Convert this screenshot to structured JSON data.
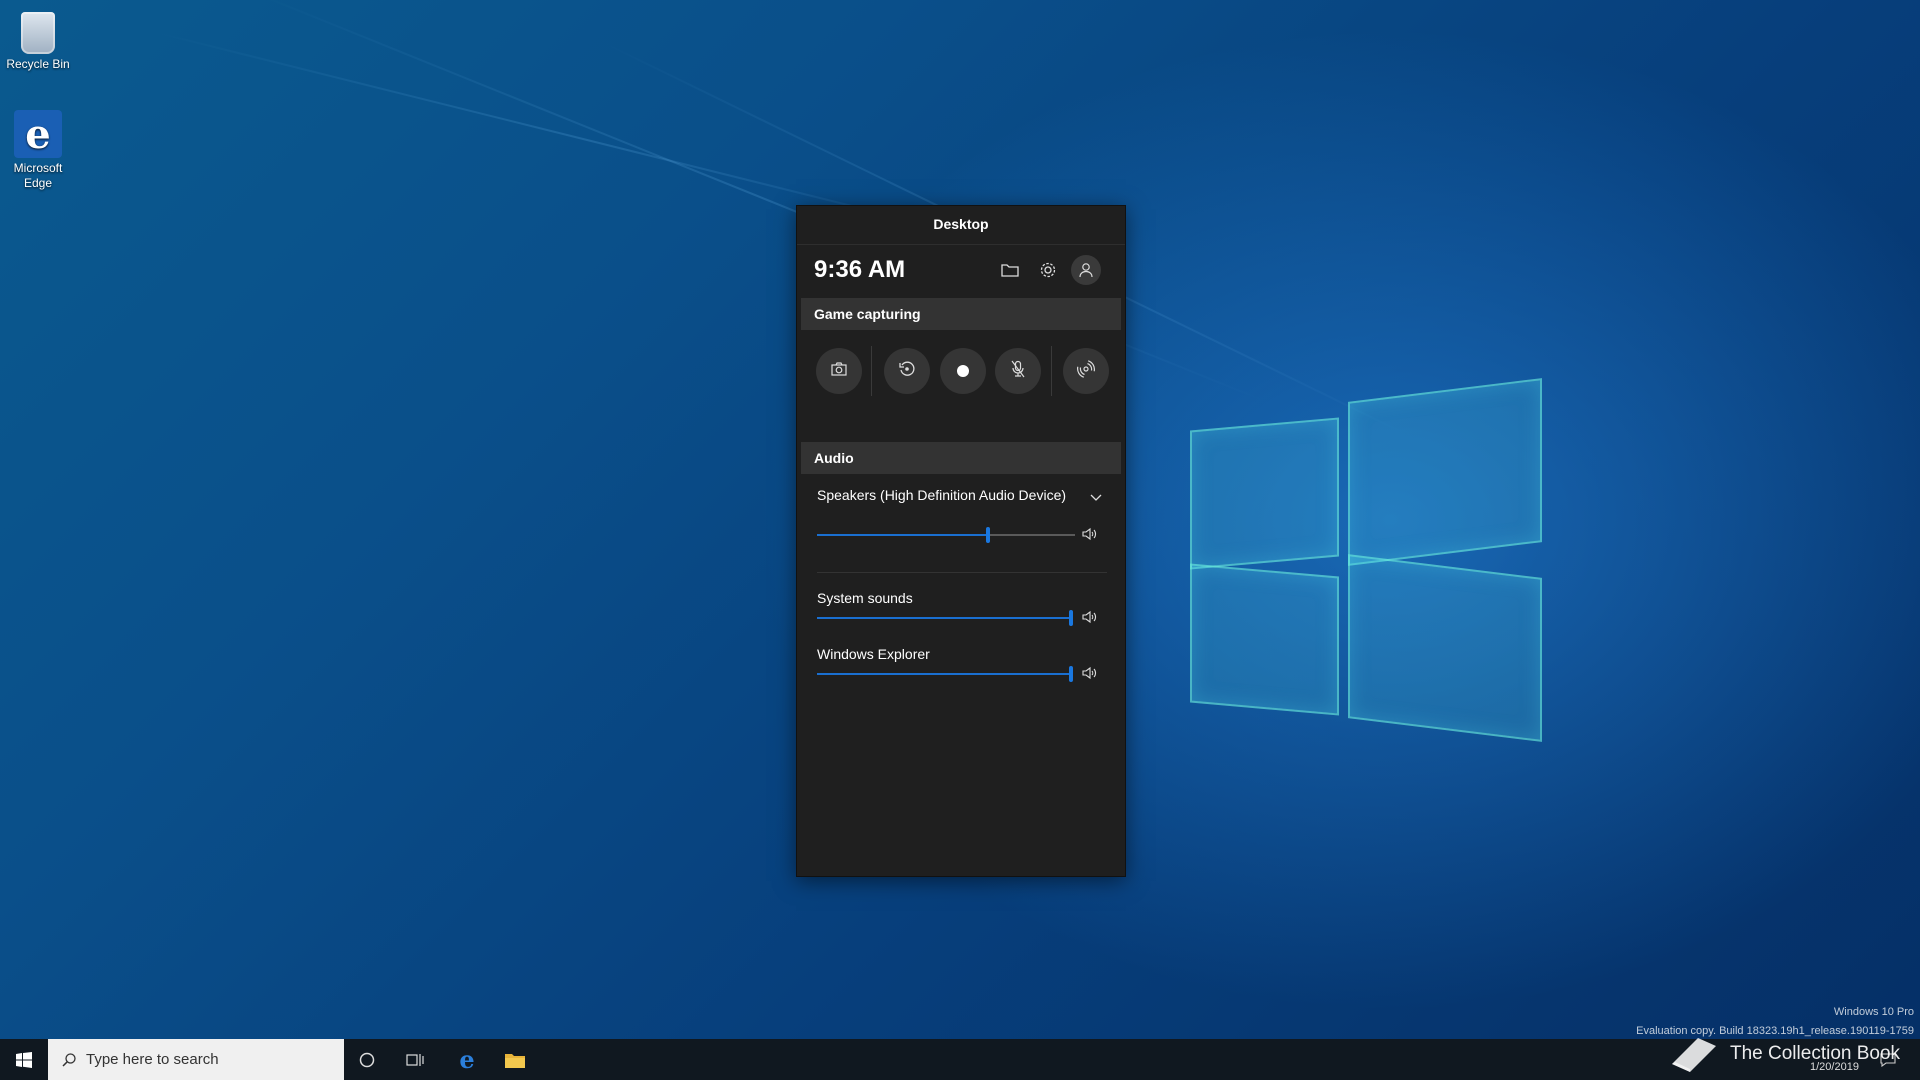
{
  "desktop": {
    "icons": [
      {
        "label": "Recycle Bin"
      },
      {
        "label": "Microsoft Edge"
      }
    ]
  },
  "gamebar": {
    "title": "Desktop",
    "time": "9:36 AM",
    "header_icons": [
      "folder-icon",
      "gear-icon",
      "user-icon"
    ],
    "capture_section": "Game capturing",
    "capture_buttons": [
      "camera-icon",
      "replay-icon",
      "record-icon",
      "mic-off-icon",
      "broadcast-icon"
    ],
    "audio_section": "Audio",
    "device": "Speakers (High Definition Audio Device)",
    "master_volume": 0.67,
    "apps": [
      {
        "name": "System sounds",
        "volume": 1.0
      },
      {
        "name": "Windows Explorer",
        "volume": 1.0
      }
    ],
    "accent": "#1a78e0"
  },
  "taskbar": {
    "search_placeholder": "Type here to search",
    "date": "1/20/2019"
  },
  "watermark": {
    "edition": "Windows 10 Pro",
    "build": "Evaluation copy. Build 18323.19h1_release.190119-1759"
  },
  "brand": "The Collection Book"
}
